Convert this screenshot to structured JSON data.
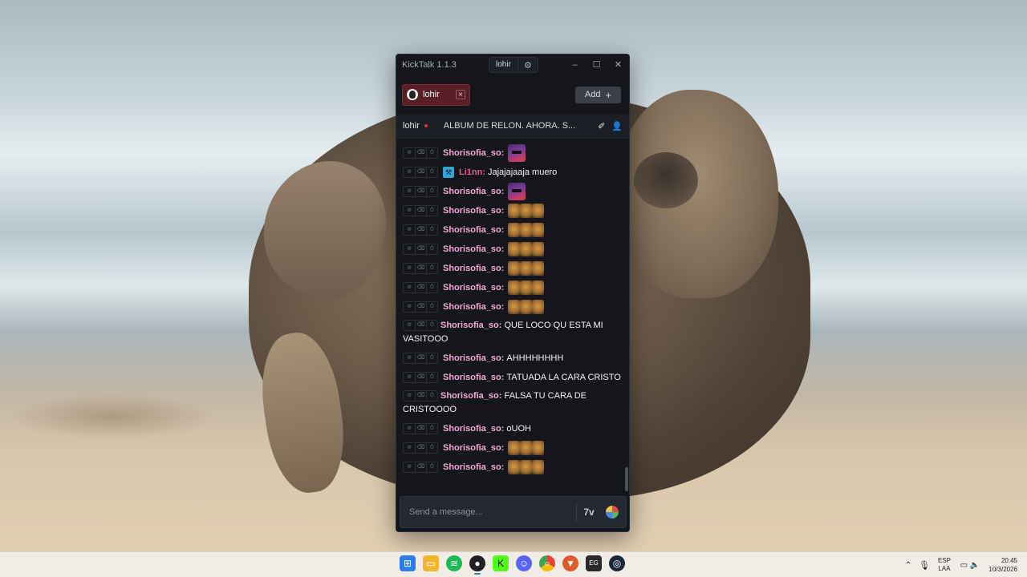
{
  "window": {
    "title": "KickTalk 1.1.3",
    "title_user": "lohir",
    "controls": [
      "–",
      "☐",
      "✕"
    ]
  },
  "tabs": [
    {
      "label": "lohir",
      "close": "×"
    }
  ],
  "add_button": {
    "label": "Add",
    "icon": "+"
  },
  "channel": {
    "name": "lohir",
    "stream_title": "ALBUM DE RELON. AHORA. S...",
    "live": true
  },
  "messages": [
    {
      "user": "Shorisofia_so:",
      "text": "",
      "emote": "big"
    },
    {
      "user": "Li1nn:",
      "text": "Jajajajaaja muero",
      "badge": "pickaxe"
    },
    {
      "user": "Shorisofia_so:",
      "text": "",
      "emote": "big"
    },
    {
      "user": "Shorisofia_so:",
      "text": "",
      "emote": "triple"
    },
    {
      "user": "Shorisofia_so:",
      "text": "",
      "emote": "triple"
    },
    {
      "user": "Shorisofia_so:",
      "text": "",
      "emote": "triple"
    },
    {
      "user": "Shorisofia_so:",
      "text": "",
      "emote": "triple"
    },
    {
      "user": "Shorisofia_so:",
      "text": "",
      "emote": "triple"
    },
    {
      "user": "Shorisofia_so:",
      "text": "",
      "emote": "triple"
    },
    {
      "user": "Shorisofia_so:",
      "text": "QUE LOCO QU ESTA MI VASITOOO"
    },
    {
      "user": "Shorisofia_so:",
      "text": "AHHHHHHHH"
    },
    {
      "user": "Shorisofia_so:",
      "text": "TATUADA LA CARA CRISTO"
    },
    {
      "user": "Shorisofia_so:",
      "text": "FALSA TU CARA DE CRISTOOOO"
    },
    {
      "user": "Shorisofia_so:",
      "text": "oUOH"
    },
    {
      "user": "Shorisofia_so:",
      "text": "",
      "emote": "triple"
    },
    {
      "user": "Shorisofia_so:",
      "text": "",
      "emote": "triple"
    }
  ],
  "composer": {
    "placeholder": "Send a message...",
    "kick_emotes_label": "7v"
  },
  "taskbar": {
    "apps": [
      "windows-start",
      "file-explorer",
      "spotify",
      "obs",
      "kick",
      "discord",
      "chrome",
      "brave",
      "epic-games",
      "steam"
    ],
    "language": "ESP",
    "layout": "LAA",
    "time": "20:45",
    "date": "10/3/2026"
  },
  "colors": {
    "accent_tab": "#5a1e27",
    "username": "#f2a9d4",
    "username_alt": "#e65a8e",
    "window_bg": "#14161c"
  }
}
